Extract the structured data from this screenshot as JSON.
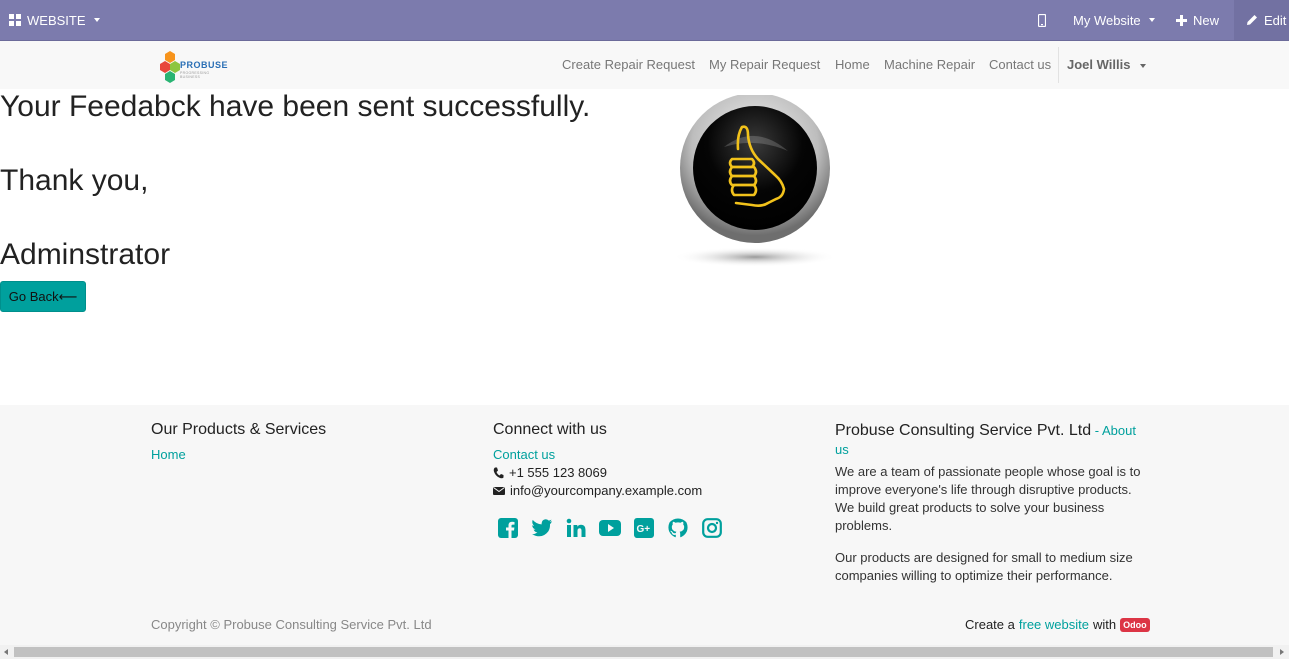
{
  "adminbar": {
    "website_menu": "WEBSITE",
    "my_website": "My Website",
    "new_label": "New",
    "edit_label": "Edit",
    "bg_color": "#7c7bad"
  },
  "navbar": {
    "logo_text": "PROBUSE",
    "logo_subtext": "PROGRESSING BUSINESS",
    "links": [
      "Create Repair Request",
      "My Repair Request",
      "Home",
      "Machine Repair",
      "Contact us"
    ],
    "user_name": "Joel Willis"
  },
  "main": {
    "line1": "Your Feedabck have been sent successfully.",
    "line2": "Thank you,",
    "line3": "Adminstrator",
    "go_back": "Go Back⟵",
    "accent_color": "#00a09d"
  },
  "footer": {
    "col1_title": "Our Products & Services",
    "col1_link": "Home",
    "col2_title": "Connect with us",
    "col2_contact": "Contact us",
    "phone": "+1 555 123 8069",
    "email": "info@yourcompany.example.com",
    "social_icons": [
      "facebook-icon",
      "twitter-icon",
      "linkedin-icon",
      "youtube-icon",
      "google-plus-icon",
      "github-icon",
      "instagram-icon"
    ],
    "col3_title": "Probuse Consulting Service Pvt. Ltd",
    "col3_sep": " - ",
    "col3_about": "About us",
    "para1": "We are a team of passionate people whose goal is to improve everyone's life through disruptive products. We build great products to solve your business problems.",
    "para2": "Our products are designed for small to medium size companies willing to optimize their performance.",
    "copyright": "Copyright © Probuse Consulting Service Pvt. Ltd",
    "create_a": "Create a",
    "free_website": "free website",
    "with": "with",
    "odoo": "Odoo"
  }
}
